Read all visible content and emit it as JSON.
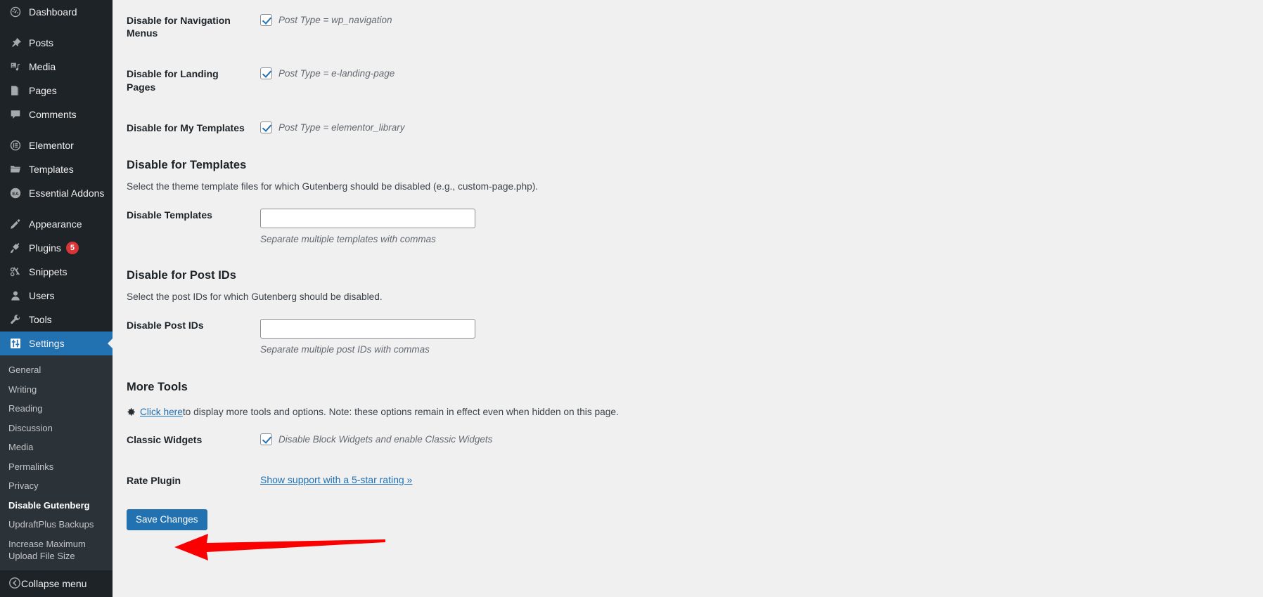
{
  "sidebar": {
    "items": [
      {
        "label": "Dashboard",
        "icon": "dashboard-icon",
        "name": "dashboard"
      },
      {
        "label": "Posts",
        "icon": "pin-icon",
        "name": "posts"
      },
      {
        "label": "Media",
        "icon": "media-icon",
        "name": "media"
      },
      {
        "label": "Pages",
        "icon": "pages-icon",
        "name": "pages"
      },
      {
        "label": "Comments",
        "icon": "comments-icon",
        "name": "comments"
      },
      {
        "label": "Elementor",
        "icon": "elementor-icon",
        "name": "elementor"
      },
      {
        "label": "Templates",
        "icon": "folder-icon",
        "name": "templates"
      },
      {
        "label": "Essential Addons",
        "icon": "essential-addons-icon",
        "name": "essential-addons"
      },
      {
        "label": "Appearance",
        "icon": "brush-icon",
        "name": "appearance"
      },
      {
        "label": "Plugins",
        "icon": "plug-icon",
        "name": "plugins",
        "badge": "5"
      },
      {
        "label": "Snippets",
        "icon": "scissors-icon",
        "name": "snippets"
      },
      {
        "label": "Users",
        "icon": "user-icon",
        "name": "users"
      },
      {
        "label": "Tools",
        "icon": "wrench-icon",
        "name": "tools"
      },
      {
        "label": "Settings",
        "icon": "sliders-icon",
        "name": "settings",
        "current": true
      }
    ],
    "submenu": [
      {
        "label": "General"
      },
      {
        "label": "Writing"
      },
      {
        "label": "Reading"
      },
      {
        "label": "Discussion"
      },
      {
        "label": "Media"
      },
      {
        "label": "Permalinks"
      },
      {
        "label": "Privacy"
      },
      {
        "label": "Disable Gutenberg",
        "current": true
      },
      {
        "label": "UpdraftPlus Backups"
      },
      {
        "label": "Increase Maximum Upload File Size"
      }
    ],
    "collapse_label": "Collapse menu",
    "accent_current": "#2271b1",
    "background": "#1d2327",
    "submenu_background": "#2c3338",
    "badge_color": "#d63638"
  },
  "main": {
    "post_type_rows": [
      {
        "label": "Disable for Navigation Menus",
        "desc": "Post Type = wp_navigation",
        "checked": true
      },
      {
        "label": "Disable for Landing Pages",
        "desc": "Post Type = e-landing-page",
        "checked": true
      },
      {
        "label": "Disable for My Templates",
        "desc": "Post Type = elementor_library",
        "checked": true
      }
    ],
    "templates_section": {
      "title": "Disable for Templates",
      "desc": "Select the theme template files for which Gutenberg should be disabled (e.g., custom-page.php).",
      "field_label": "Disable Templates",
      "field_value": "",
      "field_placeholder": "",
      "field_help": "Separate multiple templates with commas"
    },
    "postids_section": {
      "title": "Disable for Post IDs",
      "desc": "Select the post IDs for which Gutenberg should be disabled.",
      "field_label": "Disable Post IDs",
      "field_value": "",
      "field_placeholder": "",
      "field_help": "Separate multiple post IDs with commas"
    },
    "more_tools": {
      "title": "More Tools",
      "link_label": "Click here",
      "text_after": " to display more tools and options. Note: these options remain in effect even when hidden on this page.",
      "classic_widgets_label": "Classic Widgets",
      "classic_widgets_desc": "Disable Block Widgets and enable Classic Widgets",
      "classic_widgets_checked": true,
      "rate_plugin_label": "Rate Plugin",
      "rate_plugin_link": "Show support with a 5-star rating »"
    },
    "save_button_label": "Save Changes"
  },
  "annotation": {
    "arrow_color": "#ff0000",
    "arrow_points_to": "Save Changes"
  }
}
